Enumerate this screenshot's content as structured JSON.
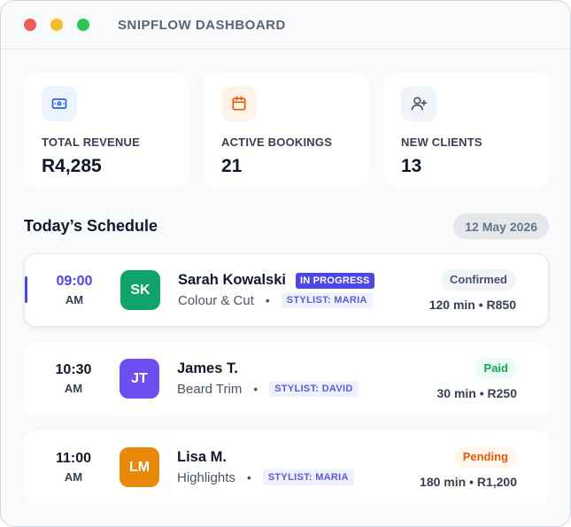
{
  "window": {
    "title": "SNIPFLOW DASHBOARD"
  },
  "stats": [
    {
      "label": "TOTAL REVENUE",
      "value": "R4,285",
      "icon": "cash-icon",
      "color": "#2563eb",
      "bg": "#eef4ff"
    },
    {
      "label": "ACTIVE BOOKINGS",
      "value": "21",
      "icon": "calendar-icon",
      "color": "#ea580c",
      "bg": "#fff4ea"
    },
    {
      "label": "NEW CLIENTS",
      "value": "13",
      "icon": "add-user-icon",
      "color": "#475569",
      "bg": "#f1f5f9"
    }
  ],
  "schedule": {
    "title": "Today’s Schedule",
    "date": "12 May 2026",
    "appointments": [
      {
        "time": "09:00",
        "ampm": "AM",
        "initials": "SK",
        "avatar_color": "#10a36a",
        "name": "Sarah Kowalski",
        "badge": "IN PROGRESS",
        "service": "Colour & Cut",
        "separator": "•",
        "stylist": "STYLIST: MARIA",
        "status": "Confirmed",
        "meta": "120 min • R850"
      },
      {
        "time": "10:30",
        "ampm": "AM",
        "initials": "JT",
        "avatar_color": "#6d4ef0",
        "name": "James T.",
        "service": "Beard Trim",
        "separator": "•",
        "stylist": "STYLIST: DAVID",
        "status": "Paid",
        "meta": "30 min • R250"
      },
      {
        "time": "11:00",
        "ampm": "AM",
        "initials": "LM",
        "avatar_color": "#e8890b",
        "name": "Lisa M.",
        "service": "Highlights",
        "separator": "•",
        "stylist": "STYLIST: MARIA",
        "status": "Pending",
        "meta": "180 min • R1,200"
      }
    ]
  }
}
